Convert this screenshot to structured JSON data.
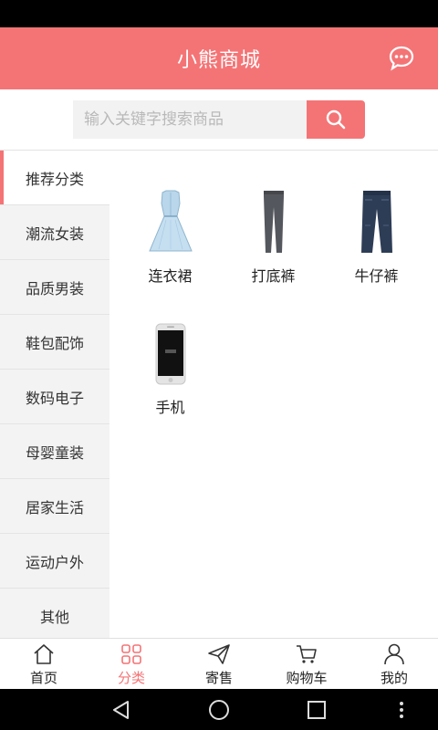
{
  "header": {
    "title": "小熊商城"
  },
  "search": {
    "placeholder": "输入关键字搜索商品"
  },
  "sidebar": {
    "items": [
      {
        "label": "推荐分类"
      },
      {
        "label": "潮流女装"
      },
      {
        "label": "品质男装"
      },
      {
        "label": "鞋包配饰"
      },
      {
        "label": "数码电子"
      },
      {
        "label": "母婴童装"
      },
      {
        "label": "居家生活"
      },
      {
        "label": "运动户外"
      },
      {
        "label": "其他"
      }
    ]
  },
  "products": [
    {
      "name": "连衣裙",
      "icon": "dress-image"
    },
    {
      "name": "打底裤",
      "icon": "leggings-image"
    },
    {
      "name": "牛仔裤",
      "icon": "jeans-image"
    },
    {
      "name": "手机",
      "icon": "phone-image"
    }
  ],
  "bottom_nav": {
    "items": [
      {
        "label": "首页",
        "icon": "home-icon"
      },
      {
        "label": "分类",
        "icon": "category-icon"
      },
      {
        "label": "寄售",
        "icon": "send-icon"
      },
      {
        "label": "购物车",
        "icon": "cart-icon"
      },
      {
        "label": "我的",
        "icon": "user-icon"
      }
    ]
  },
  "colors": {
    "accent": "#f47476",
    "sidebar_bg": "#f3f3f3"
  }
}
